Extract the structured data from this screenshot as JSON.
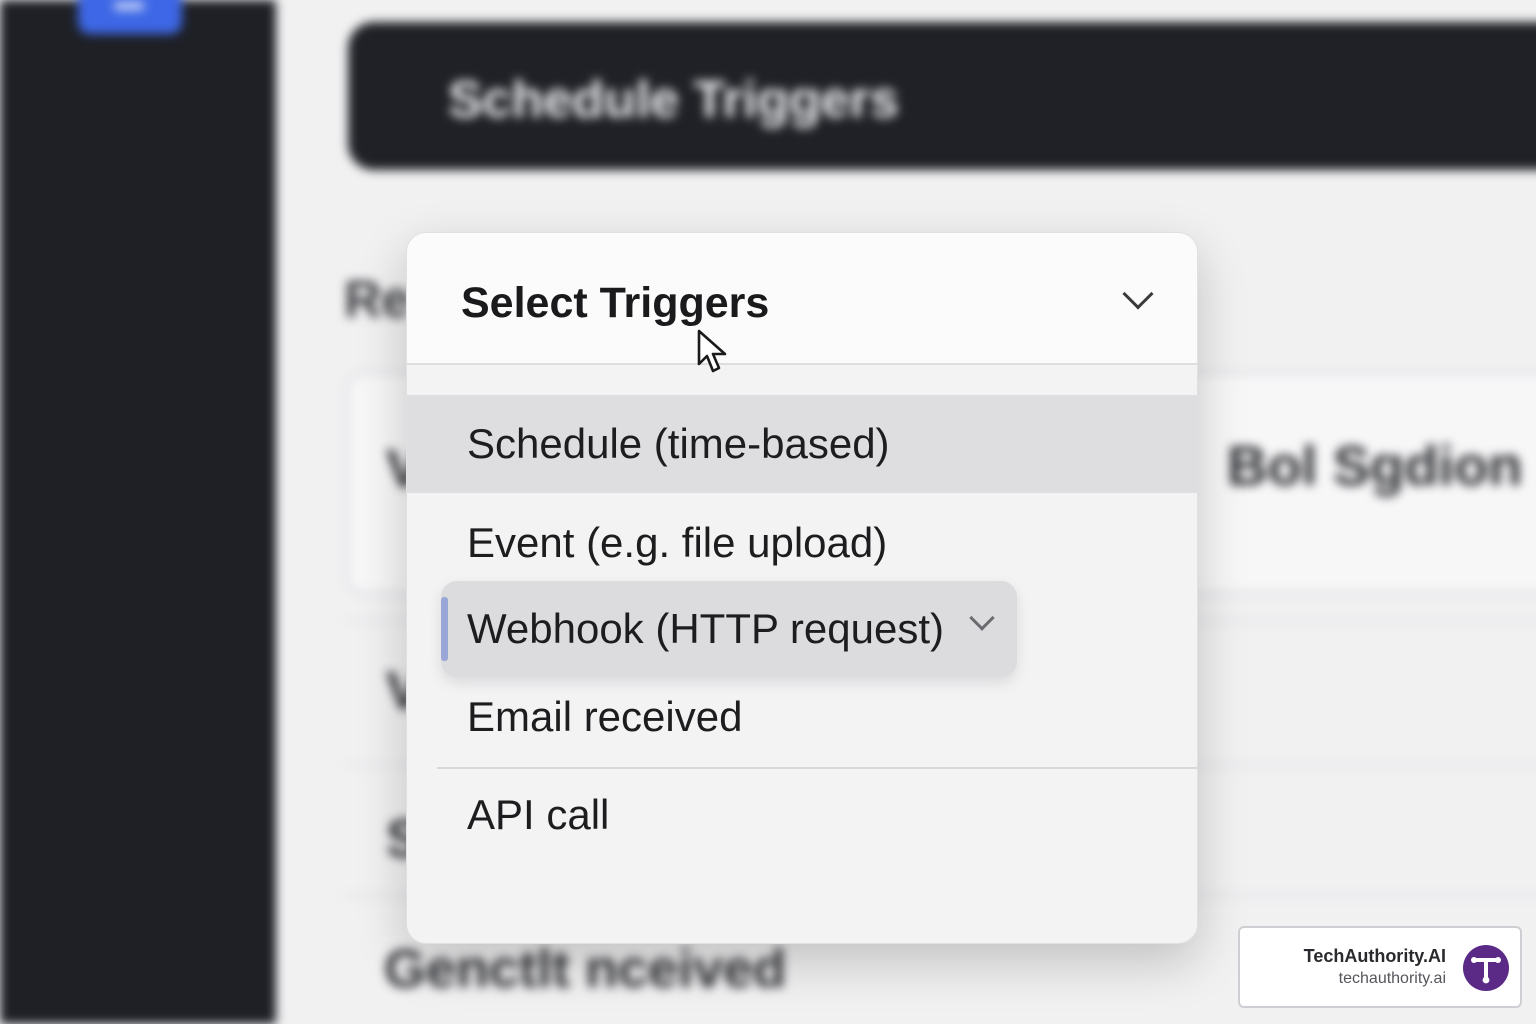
{
  "background": {
    "header_title": "Schedule Triggers",
    "section_title": "Re",
    "card_right_text": "Bol Sgdion",
    "card_glyph": "V",
    "row_glyph_1": "V",
    "row_glyph_2": "S",
    "footer_text": "Genctlt nceived"
  },
  "dropdown": {
    "title": "Select Triggers",
    "items": [
      {
        "label": "Schedule (time-based)",
        "state": "hovered"
      },
      {
        "label": "Event (e.g. file upload)"
      },
      {
        "label": "Webhook (HTTP request)",
        "state": "selected"
      },
      {
        "label": "Email received"
      },
      {
        "label": "API call"
      }
    ]
  },
  "badge": {
    "name": "TechAuthority.AI",
    "url": "techauthority.ai"
  },
  "icons": {
    "header_chevron": "chevron-down-icon",
    "webhook_chevron": "chevron-down-icon",
    "cursor": "mouse-pointer-icon",
    "logo": "techauthority-logo-icon"
  },
  "colors": {
    "sidebar": "#1e2026",
    "accent_button": "#3d67e6",
    "selected_accent": "#9aa6d6",
    "logo_purple": "#5a2a86"
  }
}
